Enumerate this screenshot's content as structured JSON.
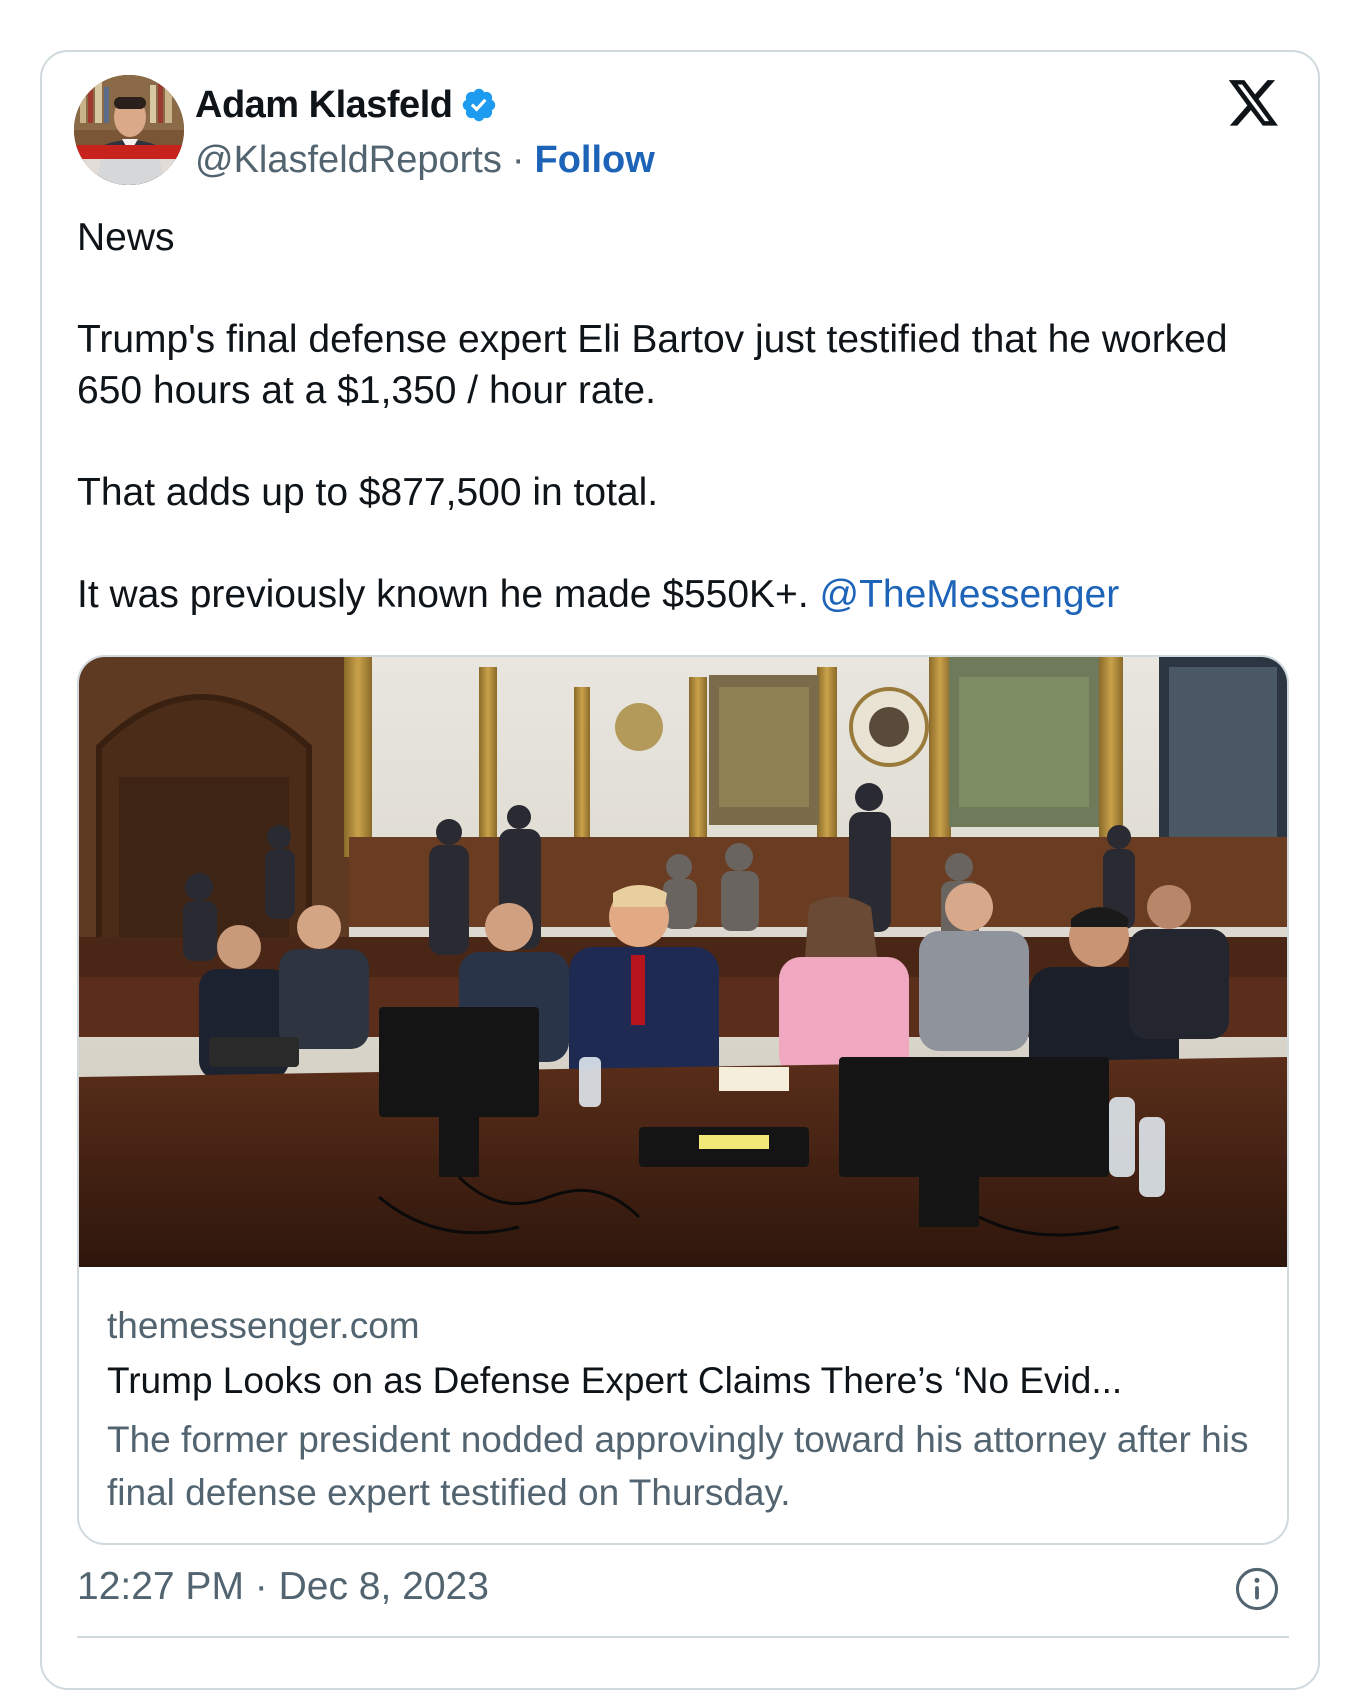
{
  "author": {
    "display_name": "Adam Klasfeld",
    "handle": "@KlasfeldReports",
    "separator": "·",
    "follow_label": "Follow",
    "verified": true
  },
  "tweet": {
    "paragraphs": [
      "News",
      "Trump's final defense expert Eli Bartov just testified that he worked 650 hours at a $1,350 / hour rate.",
      "That adds up to $877,500 in total.",
      "It was previously known he made $550K+."
    ],
    "mention": "@TheMessenger"
  },
  "link_card": {
    "domain": "themessenger.com",
    "title": "Trump Looks on as Defense Expert Claims There’s ‘No Evid...",
    "description": "The former president nodded approvingly toward his attorney after his final defense expert testified on Thursday."
  },
  "timestamp": "12:27 PM · Dec 8, 2023",
  "icons": {
    "platform_logo": "x-logo-icon",
    "verified_badge": "verified-badge-icon",
    "info": "info-icon"
  },
  "colors": {
    "link": "#1d64b8",
    "verified": "#1d9bf0",
    "secondary_text": "#536471",
    "border": "#cfd9de"
  }
}
